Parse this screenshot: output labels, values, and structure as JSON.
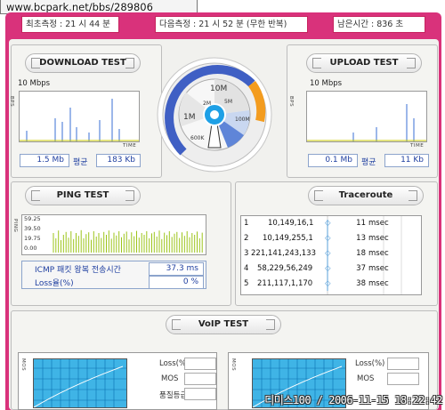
{
  "watermark": "www.bcpark.net/bbs/289806",
  "header": {
    "first_measure": "최초측정 : 21 시 44 분",
    "next_measure": "다음측정 : 21 시 52 분 (무한 반복)",
    "remaining": "남은시간 : 836 초"
  },
  "download": {
    "title": "DOWNLOAD TEST",
    "scale": "10 Mbps",
    "y_axis": "BPS",
    "x_axis": "TIME",
    "current": "1.5 Mb",
    "avg_label": "평균",
    "average": "183 Kb"
  },
  "upload": {
    "title": "UPLOAD TEST",
    "scale": "10 Mbps",
    "y_axis": "BPS",
    "x_axis": "TIME",
    "current": "0.1 Mb",
    "avg_label": "평균",
    "average": "11 Kb"
  },
  "gauge": {
    "labels": [
      "10M",
      "5M",
      "2M",
      "1M",
      "100M",
      "600K"
    ],
    "colors": {
      "outer": "#3f5fc4",
      "accent": "#f39c1f",
      "center": "#1ea0e6"
    }
  },
  "ping": {
    "title": "PING TEST",
    "y_axis": "PING",
    "ticks": [
      "59.25",
      "39.50",
      "19.75",
      "0.00"
    ],
    "icmp_label": "ICMP 패킷 왕복 전송시간",
    "icmp_value": "37.3 ms",
    "loss_label": "Loss율(%)",
    "loss_value": "0 %",
    "bar_heights": [
      0.55,
      0.4,
      0.62,
      0.35,
      0.5,
      0.58,
      0.42,
      0.6,
      0.38,
      0.55,
      0.47,
      0.63,
      0.4,
      0.52,
      0.57,
      0.36,
      0.6,
      0.45,
      0.55,
      0.41,
      0.58,
      0.5,
      0.62,
      0.39,
      0.56,
      0.48,
      0.6,
      0.43,
      0.53,
      0.59,
      0.37,
      0.57,
      0.46,
      0.61,
      0.42,
      0.55,
      0.5,
      0.6,
      0.4,
      0.54,
      0.58,
      0.45,
      0.62,
      0.38,
      0.56,
      0.49,
      0.6,
      0.44,
      0.53,
      0.58,
      0.41,
      0.57,
      0.47,
      0.6,
      0.43,
      0.55,
      0.5,
      0.59,
      0.4,
      0.56
    ]
  },
  "traceroute": {
    "title": "Traceroute",
    "rows": [
      {
        "hop": "1",
        "ip": "10,149,16,1",
        "ms": "11",
        "unit": "msec"
      },
      {
        "hop": "2",
        "ip": "10,149,255,1",
        "ms": "13",
        "unit": "msec"
      },
      {
        "hop": "3",
        "ip": "221,141,243,133",
        "ms": "18",
        "unit": "msec"
      },
      {
        "hop": "4",
        "ip": "58,229,56,249",
        "ms": "37",
        "unit": "msec"
      },
      {
        "hop": "5",
        "ip": "211,117,1,170",
        "ms": "38",
        "unit": "msec"
      }
    ]
  },
  "voip": {
    "title": "VoIP TEST",
    "y_axis": "MOS",
    "loss_label": "Loss(%)",
    "mos_label": "MOS",
    "grade_label": "품질등급"
  },
  "timestamp": "디미스100 / 2006-11-15 18:22:42"
}
